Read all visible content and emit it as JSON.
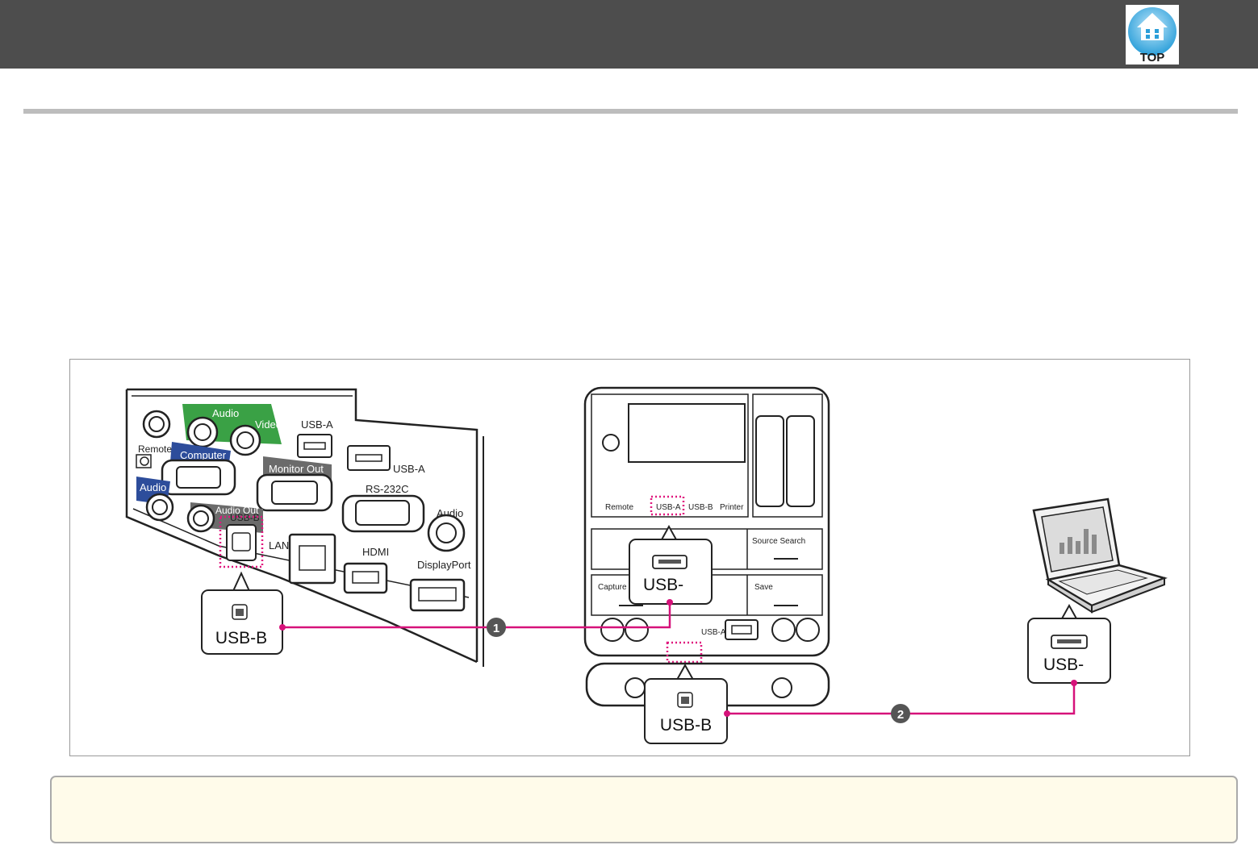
{
  "header": {
    "top_button_label": "TOP"
  },
  "figure": {
    "wall_panel": {
      "ports": {
        "audio_green": "Audio",
        "video": "Video",
        "usb_a_1": "USB-A",
        "usb_a_2": "USB-A",
        "remote": "Remote",
        "computer": "Computer",
        "monitor_out": "Monitor Out",
        "audio_blue": "Audio",
        "rs232c": "RS-232C",
        "audio_out": "Audio Out",
        "audio_right": "Audio",
        "usb_b": "USB-B",
        "lan": "LAN",
        "hdmi": "HDMI",
        "displayport": "DisplayPort"
      },
      "callout_label": "USB-B"
    },
    "control_pad": {
      "top_labels": [
        "Remote",
        "USB-A",
        "USB-B",
        "Printer"
      ],
      "buttons": [
        "Source Search",
        "Capture",
        "Save"
      ],
      "front_port": "USB-A",
      "callout_usb_a": "USB-",
      "callout_usb_b": "USB-B"
    },
    "laptop": {
      "callout_label": "USB-"
    },
    "connection_markers": [
      "1",
      "2"
    ],
    "colors": {
      "connection_line": "#d6127a",
      "highlight": "#e0187e"
    }
  }
}
